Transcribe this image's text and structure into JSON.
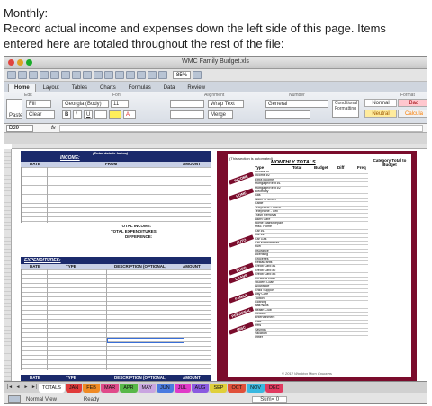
{
  "caption": {
    "line1": "Monthly:",
    "line2": "Record actual income and expenses down the left side of this page. Items entered here are totaled throughout the rest of the file:"
  },
  "window": {
    "title": "WMC Family Budget.xls",
    "zoom": "85%",
    "traffic_colors": [
      "#e0443e",
      "#dea123",
      "#1aab29"
    ]
  },
  "ribbon": {
    "tabs": [
      "Home",
      "Layout",
      "Tables",
      "Charts",
      "Formulas",
      "Data",
      "Review"
    ],
    "active_tab": "Home",
    "groups": {
      "edit": "Edit",
      "font": "Font",
      "alignment": "Alignment",
      "number": "Number",
      "format": "Format"
    },
    "fill": "Fill",
    "clear": "Clear",
    "paste": "Paste",
    "font_name": "Georgia (Body)",
    "font_size": "11",
    "wrap_text": "Wrap Text",
    "number_format": "General",
    "merge": "Merge",
    "conditional": "Conditional Formatting",
    "styles": {
      "normal": "Normal",
      "bad": "Bad",
      "neutral": "Neutral",
      "calc": "Calcula"
    }
  },
  "formula_bar": {
    "cell_ref": "D29",
    "fx": "fx"
  },
  "left_panel": {
    "income_title": "INCOME:",
    "enter_note": "(Enter details below)",
    "income_cols": [
      "DATE",
      "FROM",
      "AMOUNT"
    ],
    "total_income": "TOTAL INCOME:",
    "total_expenditures": "TOTAL EXPENDITURES:",
    "difference": "DIFFERENCE:",
    "expenditures_title": "EXPENDITURES:",
    "exp_cols": [
      "DATE",
      "TYPE",
      "DESCRIPTION (OPTIONAL)",
      "AMOUNT"
    ],
    "bottom_cols": [
      "DATE",
      "TYPE",
      "DESCRIPTION (OPTIONAL)",
      "AMOUNT"
    ]
  },
  "right_panel": {
    "note": "(This section is automated)",
    "title": "MONTHLY TOTALS",
    "cols": [
      "Type",
      "Total",
      "Budget",
      "Diff",
      "Freq"
    ],
    "cat_header": "Category Total to Budget",
    "groups": [
      "INCOME",
      "HOME",
      "AUTO",
      "FOOD",
      "LOANS",
      "FAMILY",
      "PERSONAL",
      "MISC"
    ],
    "types": [
      "Income #1",
      "Income #2",
      "Extra Income",
      "Mortgage/Rent #1",
      "Mortgage/Rent #2",
      "Electricity",
      "Gas",
      "Water & Sewer",
      "Cable",
      "Telephone - Home",
      "Telephone - Cell",
      "Trash Removal",
      "Lawn Care",
      "Home Maint/Repair",
      "Misc. Home",
      "Car #1",
      "Car #2",
      "Car Gas",
      "Car Maint/Repair",
      "Fuel",
      "Insurance",
      "Licensing",
      "Groceries",
      "Restaurants",
      "Credit Card #1",
      "Credit Card #2",
      "Credit Card #3",
      "Personal Loan",
      "Student Loan",
      "Allowance",
      "Child Support",
      "Day Care",
      "Tuition",
      "Clothing",
      "Hair/Nails",
      "Health Club",
      "Medical",
      "Entertainment",
      "Gifts",
      "Pets",
      "Savings",
      "Vacation",
      "Other"
    ],
    "copyright": "© 2012 Working Mom Coupons"
  },
  "sheet_tabs": {
    "nav": [
      "|◄",
      "◄",
      "►",
      "►|"
    ],
    "tabs": [
      {
        "label": "TOTALS",
        "color": "#ffffff"
      },
      {
        "label": "JAN",
        "color": "#e03a3a"
      },
      {
        "label": "FEB",
        "color": "#f08a24"
      },
      {
        "label": "MAR",
        "color": "#e04a8a"
      },
      {
        "label": "APR",
        "color": "#58b848"
      },
      {
        "label": "MAY",
        "color": "#c9a5e0"
      },
      {
        "label": "JUN",
        "color": "#4a7be0"
      },
      {
        "label": "JUL",
        "color": "#e03ac8"
      },
      {
        "label": "AUG",
        "color": "#8a5ae0"
      },
      {
        "label": "SEP",
        "color": "#e0d03a"
      },
      {
        "label": "OCT",
        "color": "#e0503a"
      },
      {
        "label": "NOV",
        "color": "#3ab8e0"
      },
      {
        "label": "DEC",
        "color": "#e03a60"
      }
    ]
  },
  "status": {
    "view": "Normal View",
    "ready": "Ready",
    "sum": "Sum= 0"
  }
}
